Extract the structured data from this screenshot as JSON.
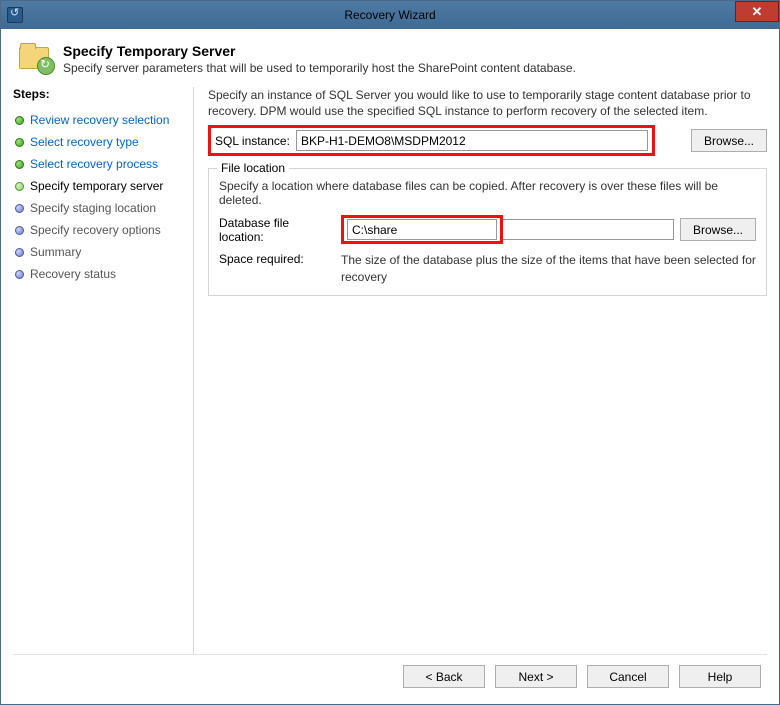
{
  "window": {
    "title": "Recovery Wizard",
    "close_label": "✕"
  },
  "header": {
    "title": "Specify Temporary Server",
    "subtitle": "Specify server parameters that will be used to temporarily host the SharePoint content database."
  },
  "sidebar": {
    "title": "Steps:",
    "items": [
      {
        "label": "Review recovery selection",
        "state": "done-link"
      },
      {
        "label": "Select recovery type",
        "state": "done-link"
      },
      {
        "label": "Select recovery process",
        "state": "done-link"
      },
      {
        "label": "Specify temporary server",
        "state": "current"
      },
      {
        "label": "Specify staging location",
        "state": "future"
      },
      {
        "label": "Specify recovery options",
        "state": "future"
      },
      {
        "label": "Summary",
        "state": "future"
      },
      {
        "label": "Recovery status",
        "state": "future"
      }
    ]
  },
  "main": {
    "description": "Specify an instance of SQL Server you would like to use to temporarily stage content database prior to recovery. DPM would use the specified SQL instance to perform recovery of the selected item.",
    "sql_label": "SQL instance:",
    "sql_value": "BKP-H1-DEMO8\\MSDPM2012",
    "browse_label": "Browse...",
    "fieldset_title": "File location",
    "fieldset_desc": "Specify a location where database files can be copied. After recovery is over these files will be deleted.",
    "dbloc_label": "Database file location:",
    "dbloc_value": "C:\\share",
    "space_label": "Space required:",
    "space_text": "The size of the database plus the size of the items that have been selected for recovery"
  },
  "buttons": {
    "back": "< Back",
    "next": "Next >",
    "cancel": "Cancel",
    "help": "Help"
  }
}
